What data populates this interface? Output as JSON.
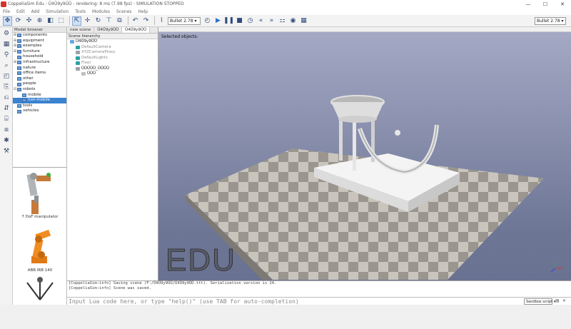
{
  "window": {
    "title": "CoppeliaSim Edu - Ü4Ü9y9ÜÜ - rendering: 8 ms (7.98 fps) - SIMULATION STOPPED",
    "minimize": "—",
    "maximize": "☐",
    "close": "✕"
  },
  "menu": [
    "File",
    "Edit",
    "Add",
    "Simulation",
    "Tools",
    "Modules",
    "Scenes",
    "Help"
  ],
  "toolbar": {
    "engine_value": "Bullet 2.78",
    "render_value": "Bullet 2.78",
    "icons": [
      "camera-pan-icon",
      "camera-rotate-icon",
      "camera-shift-icon",
      "camera-zoom-icon",
      "fit-view-icon",
      "object-select-icon",
      "object-shift-icon",
      "object-rotate-icon",
      "assemble-icon",
      "undo-icon",
      "redo-icon",
      "play-icon",
      "pause-icon",
      "stop-icon",
      "realtime-icon",
      "slower-icon",
      "faster-icon",
      "thread-icon",
      "visualize-icon"
    ]
  },
  "model_browser": {
    "header": "Model browser",
    "items": [
      {
        "label": "components",
        "exp": "⊞",
        "indent": 0
      },
      {
        "label": "equipment",
        "exp": "⊞",
        "indent": 0
      },
      {
        "label": "examples",
        "exp": "⊞",
        "indent": 0
      },
      {
        "label": "furniture",
        "exp": "⊞",
        "indent": 0
      },
      {
        "label": "household",
        "exp": "",
        "indent": 0
      },
      {
        "label": "infrastructure",
        "exp": "⊞",
        "indent": 0
      },
      {
        "label": "nature",
        "exp": "",
        "indent": 0
      },
      {
        "label": "office items",
        "exp": "",
        "indent": 0
      },
      {
        "label": "other",
        "exp": "",
        "indent": 0
      },
      {
        "label": "people",
        "exp": "",
        "indent": 0
      },
      {
        "label": "robots",
        "exp": "⊟",
        "indent": 0
      },
      {
        "label": "mobile",
        "exp": "",
        "indent": 1
      },
      {
        "label": "non-mobile",
        "exp": "",
        "indent": 1,
        "selected": true
      },
      {
        "label": "tools",
        "exp": "",
        "indent": 0
      },
      {
        "label": "vehicles",
        "exp": "",
        "indent": 0
      }
    ],
    "thumbs": [
      {
        "label": "7 DoF manipulator"
      },
      {
        "label": "ABB IRB 140"
      },
      {
        "label": ""
      }
    ]
  },
  "scene_panel": {
    "tabs": [
      {
        "label": "new scene",
        "active": false
      },
      {
        "label": "Ü4Ü9y9ÜÜ",
        "active": false
      },
      {
        "label": "Ü4Ü9y9ÜÜ",
        "active": true
      }
    ],
    "header": "Scene hierarchy",
    "rows": [
      {
        "label": "Ü4Ü9y9ÜÜ",
        "color": "#6da6e0",
        "indent": 0,
        "dark": true
      },
      {
        "label": "DefaultCamera",
        "color": "#2aa1a6",
        "indent": 1
      },
      {
        "label": "XYZCameraProxy",
        "color": "#9aa0a8",
        "indent": 1
      },
      {
        "label": "DefaultLights",
        "color": "#2aa1a6",
        "indent": 1
      },
      {
        "label": "Floor",
        "color": "#2aa1a6",
        "indent": 1
      },
      {
        "label": "ÜÜÜÜÜ_ÜÜÜÜ",
        "color": "#9aa0a8",
        "indent": 1,
        "dark": true
      },
      {
        "label": "ÜÜÜ",
        "color": "#c0c0c0",
        "indent": 2,
        "dark": true
      }
    ]
  },
  "viewport": {
    "label": "Selected objects:",
    "watermark": "EDU"
  },
  "console": {
    "lines": [
      "[CoppeliaSim:info]  Saving scene (F:/Ü4Ü9y9ÜÜ/Ü4Ü9y9ÜÜ.ttt). Serialization version is 24.",
      "[CoppeliaSim:info]  Scene was saved."
    ],
    "input_placeholder": "Input Lua code here, or type \"help()\" (use TAB for auto-completion)",
    "script_select": "Sandbox script",
    "btn_a": "▤",
    "btn_b": "✕"
  }
}
